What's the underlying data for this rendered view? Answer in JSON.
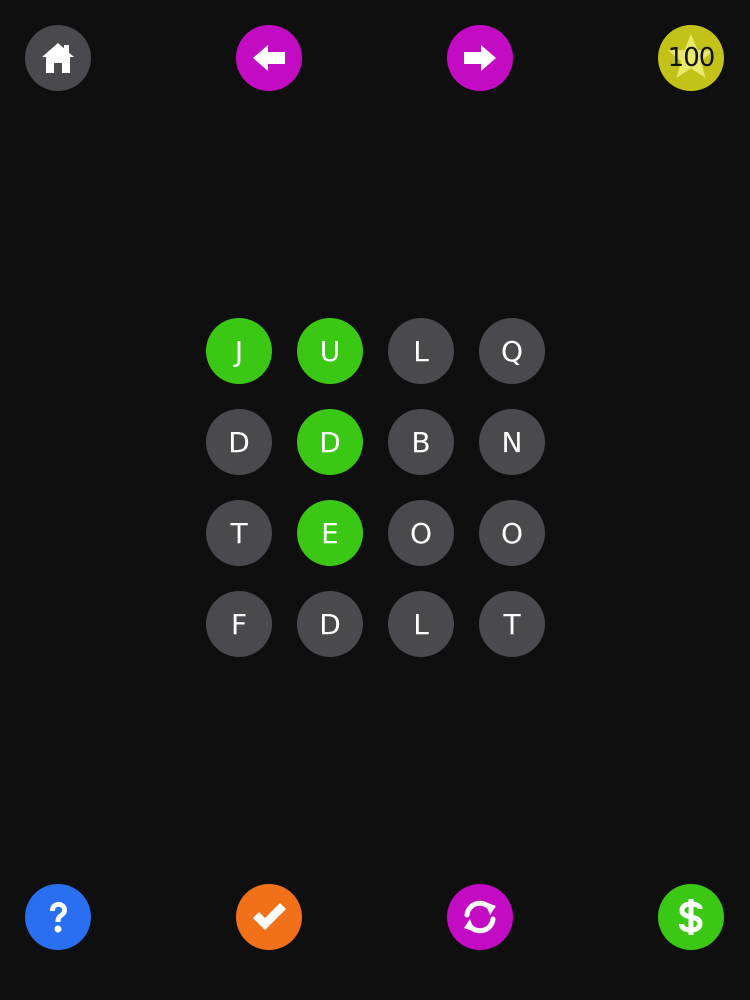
{
  "colors": {
    "background": "#0f0f10",
    "tile_default": "#4a4a4e",
    "tile_selected": "#3ac814",
    "magenta": "#c40bc4",
    "coin": "#c2c218",
    "help": "#2a6ef2",
    "check": "#f2701a",
    "shop": "#3ac814"
  },
  "top_bar": {
    "home_icon": "house-icon",
    "prev_icon": "arrow-left-icon",
    "next_icon": "arrow-right-icon",
    "coins": "100",
    "coin_icon": "star-icon"
  },
  "bottom_bar": {
    "help_icon": "question-mark-icon",
    "check_icon": "checkmark-icon",
    "refresh_icon": "refresh-icon",
    "shop_icon": "dollar-icon"
  },
  "board": {
    "rows": [
      [
        {
          "letter": "J",
          "selected": true
        },
        {
          "letter": "U",
          "selected": true
        },
        {
          "letter": "L",
          "selected": false
        },
        {
          "letter": "Q",
          "selected": false
        }
      ],
      [
        {
          "letter": "D",
          "selected": false
        },
        {
          "letter": "D",
          "selected": true
        },
        {
          "letter": "B",
          "selected": false
        },
        {
          "letter": "N",
          "selected": false
        }
      ],
      [
        {
          "letter": "T",
          "selected": false
        },
        {
          "letter": "E",
          "selected": true
        },
        {
          "letter": "O",
          "selected": false
        },
        {
          "letter": "O",
          "selected": false
        }
      ],
      [
        {
          "letter": "F",
          "selected": false
        },
        {
          "letter": "D",
          "selected": false
        },
        {
          "letter": "L",
          "selected": false
        },
        {
          "letter": "T",
          "selected": false
        }
      ]
    ]
  }
}
